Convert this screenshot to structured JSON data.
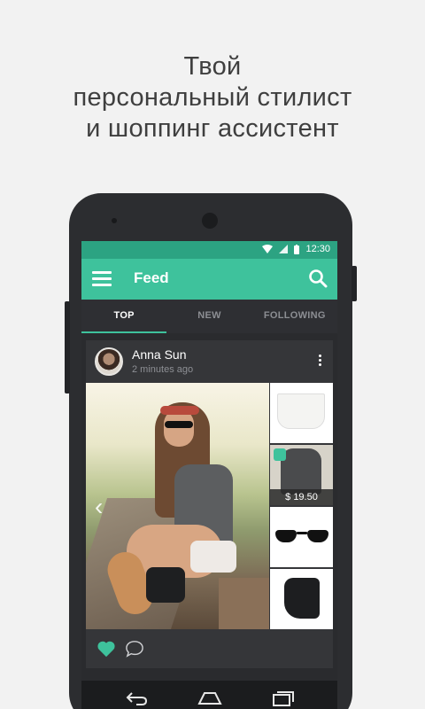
{
  "promo": {
    "line1": "Твой",
    "line2": "персональный стилист",
    "line3": "и шоппинг ассистент"
  },
  "statusbar": {
    "time": "12:30"
  },
  "appbar": {
    "title": "Feed"
  },
  "tabs": [
    {
      "label": "TOP",
      "active": true
    },
    {
      "label": "NEW",
      "active": false
    },
    {
      "label": "FOLLOWING",
      "active": false
    }
  ],
  "post": {
    "author": "Anna Sun",
    "time": "2 minutes ago",
    "items": [
      {
        "name": "white-shorts"
      },
      {
        "name": "gray-tank-top",
        "price": "$ 19.50"
      },
      {
        "name": "sunglasses"
      },
      {
        "name": "black-boots"
      }
    ]
  },
  "colors": {
    "accent": "#3ec29c",
    "statusbar": "#2ca382",
    "screen": "#2a2b2e"
  }
}
